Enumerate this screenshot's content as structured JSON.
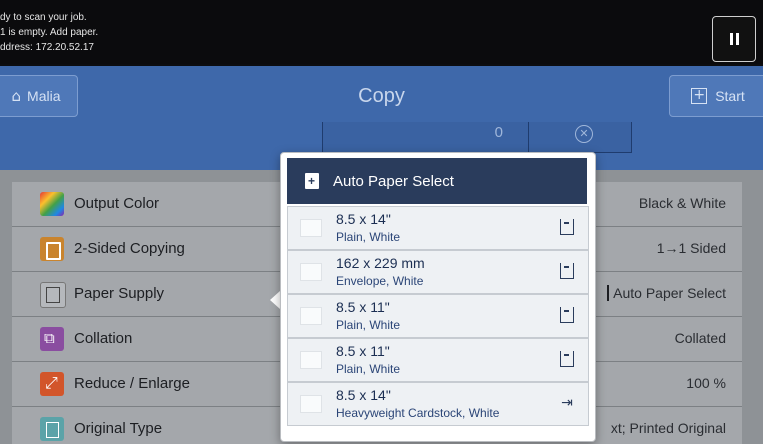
{
  "status": {
    "lines": [
      "dy to scan your job.",
      "1 is empty.  Add paper.",
      "ddress: 172.20.52.17"
    ]
  },
  "header": {
    "title": "Copy",
    "user_button": "Malia",
    "start_button": "Start"
  },
  "quantity": {
    "value": "0"
  },
  "features": [
    {
      "label": "Output Color",
      "value": "Black & White",
      "icon": "output-color-icon"
    },
    {
      "label": "2-Sided Copying",
      "value": "1→1 Sided",
      "icon": "two-sided-icon"
    },
    {
      "label": "Paper Supply",
      "value": "Auto Paper Select",
      "icon": "paper-supply-icon"
    },
    {
      "label": "Collation",
      "value": "Collated",
      "icon": "collation-icon"
    },
    {
      "label": "Reduce / Enlarge",
      "value": "100 %",
      "icon": "reduce-enlarge-icon"
    },
    {
      "label": "Original Type",
      "value": "xt; Printed Original",
      "icon": "original-type-icon"
    }
  ],
  "paper_popup": {
    "header_label": "Auto Paper Select",
    "trays": [
      {
        "size": "8.5 x 14\"",
        "type": "Plain, White",
        "icon": "tray-1-icon"
      },
      {
        "size": "162 x 229 mm",
        "type": "Envelope, White",
        "icon": "tray-2-icon"
      },
      {
        "size": "8.5 x 11\"",
        "type": "Plain, White",
        "icon": "tray-3-icon"
      },
      {
        "size": "8.5 x 11\"",
        "type": "Plain, White",
        "icon": "tray-4-icon"
      },
      {
        "size": "8.5 x 14\"",
        "type": "Heavyweight Cardstock, White",
        "icon": "bypass-tray-icon"
      }
    ]
  },
  "colors": {
    "header_blue": "#3e68aa",
    "popup_header": "#2a3c5c",
    "panel_gray": "#8e9296"
  }
}
